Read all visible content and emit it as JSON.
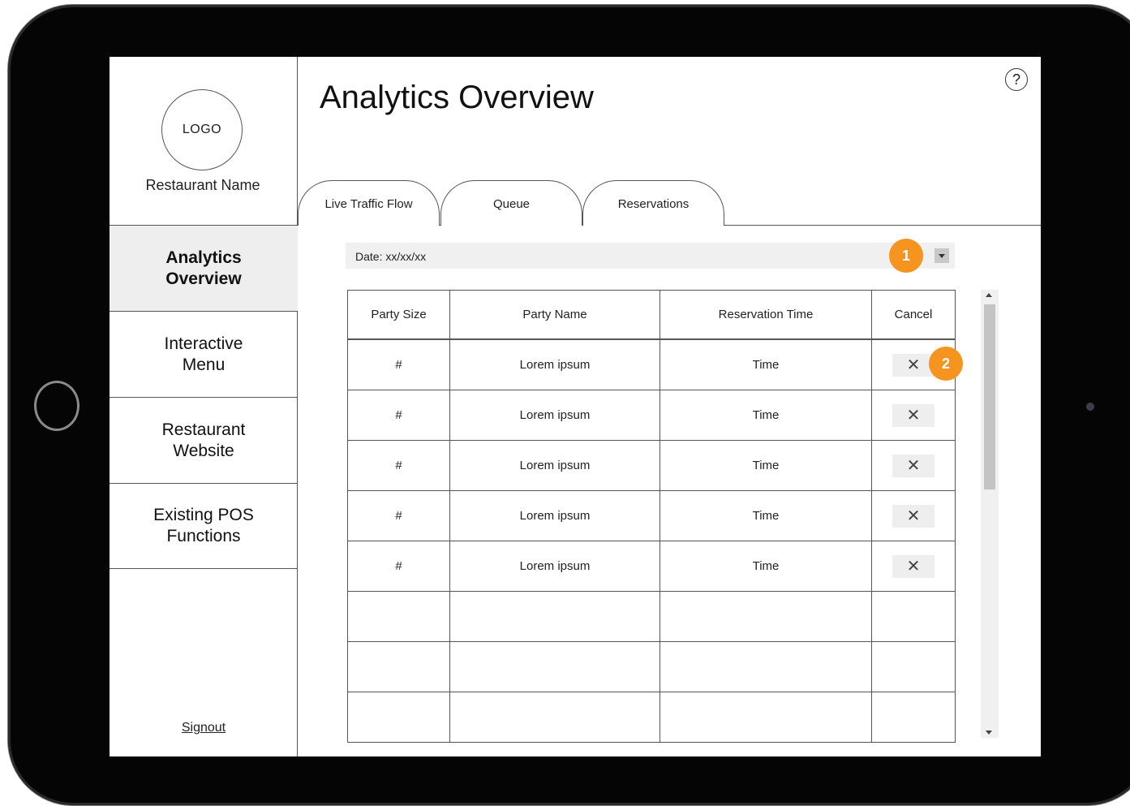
{
  "sidebar": {
    "logo_text": "LOGO",
    "restaurant_name": "Restaurant Name",
    "nav": [
      {
        "label": "Analytics\nOverview",
        "active": true
      },
      {
        "label": "Interactive\nMenu",
        "active": false
      },
      {
        "label": "Restaurant\nWebsite",
        "active": false
      },
      {
        "label": "Existing POS\nFunctions",
        "active": false
      }
    ],
    "signout": "Signout"
  },
  "header": {
    "title": "Analytics Overview",
    "help_icon": "?"
  },
  "tabs": [
    "Live Traffic Flow",
    "Queue",
    "Reservations"
  ],
  "filter": {
    "date_label": "Date: xx/xx/xx"
  },
  "annotations": {
    "marker1": "1",
    "marker2": "2"
  },
  "table": {
    "columns": [
      "Party Size",
      "Party Name",
      "Reservation Time",
      "Cancel"
    ],
    "rows": [
      {
        "party_size": "#",
        "party_name": "Lorem ipsum",
        "time": "Time",
        "cancel": "✕"
      },
      {
        "party_size": "#",
        "party_name": "Lorem ipsum",
        "time": "Time",
        "cancel": "✕"
      },
      {
        "party_size": "#",
        "party_name": "Lorem ipsum",
        "time": "Time",
        "cancel": "✕"
      },
      {
        "party_size": "#",
        "party_name": "Lorem ipsum",
        "time": "Time",
        "cancel": "✕"
      },
      {
        "party_size": "#",
        "party_name": "Lorem ipsum",
        "time": "Time",
        "cancel": "✕"
      }
    ]
  },
  "colors": {
    "marker": "#f5941e",
    "active_nav_bg": "#eeeeee"
  }
}
